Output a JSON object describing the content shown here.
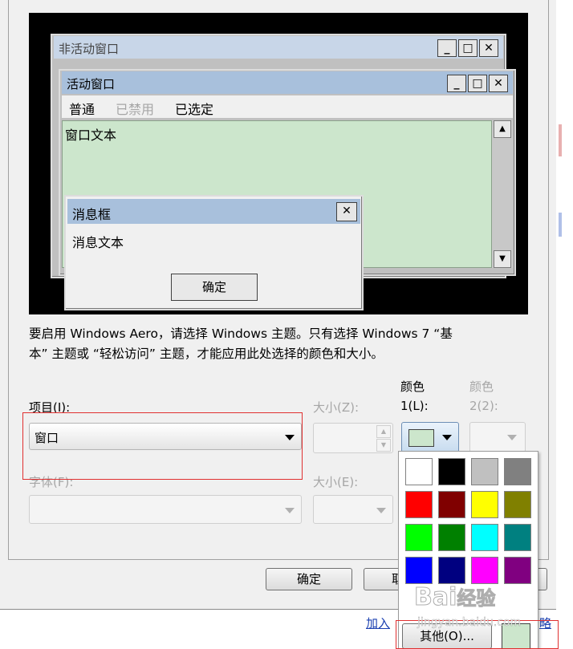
{
  "preview": {
    "inactive_title": "非活动窗口",
    "active_title": "活动窗口",
    "menu": {
      "normal": "普通",
      "disabled": "已禁用",
      "selected": "已选定"
    },
    "window_text": "窗口文本",
    "message_title": "消息框",
    "message_text": "消息文本",
    "message_ok": "确定",
    "btn_min": "_",
    "btn_max": "□",
    "btn_close": "✕"
  },
  "info_text_line1": "要启用 Windows Aero，请选择 Windows 主题。只有选择 Windows 7 “基",
  "info_text_line2": "本” 主题或 “轻松访问” 主题，才能应用此处选择的颜色和大小。",
  "form": {
    "item_label": "项目(I):",
    "item_value": "窗口",
    "size_z_label": "大小(Z):",
    "color1_label_top": "颜色",
    "color1_label_bottom": "1(L):",
    "color2_label_top": "颜色",
    "color2_label_bottom": "2(2):",
    "font_label": "字体(F):",
    "size_e_label": "大小(E):",
    "color1_value": "#cce6cc"
  },
  "palette": {
    "colors": [
      "#ffffff",
      "#000000",
      "#c0c0c0",
      "#808080",
      "#ff0000",
      "#800000",
      "#ffff00",
      "#808000",
      "#00ff00",
      "#008000",
      "#00ffff",
      "#008080",
      "#0000ff",
      "#000080",
      "#ff00ff",
      "#800080"
    ],
    "other_button": "其他(O)..."
  },
  "buttons": {
    "ok": "确定",
    "cancel": "取"
  },
  "page_links": {
    "join": "加入"
  },
  "watermark": {
    "brand": "Bai",
    "brand2": "经验",
    "url": "jingyan.baidu.com"
  },
  "colors": {
    "active_title": "#a8c0dc",
    "inactive_title": "#c8d6e8",
    "window_bg": "#cce6cc",
    "highlight": "#e03030"
  }
}
